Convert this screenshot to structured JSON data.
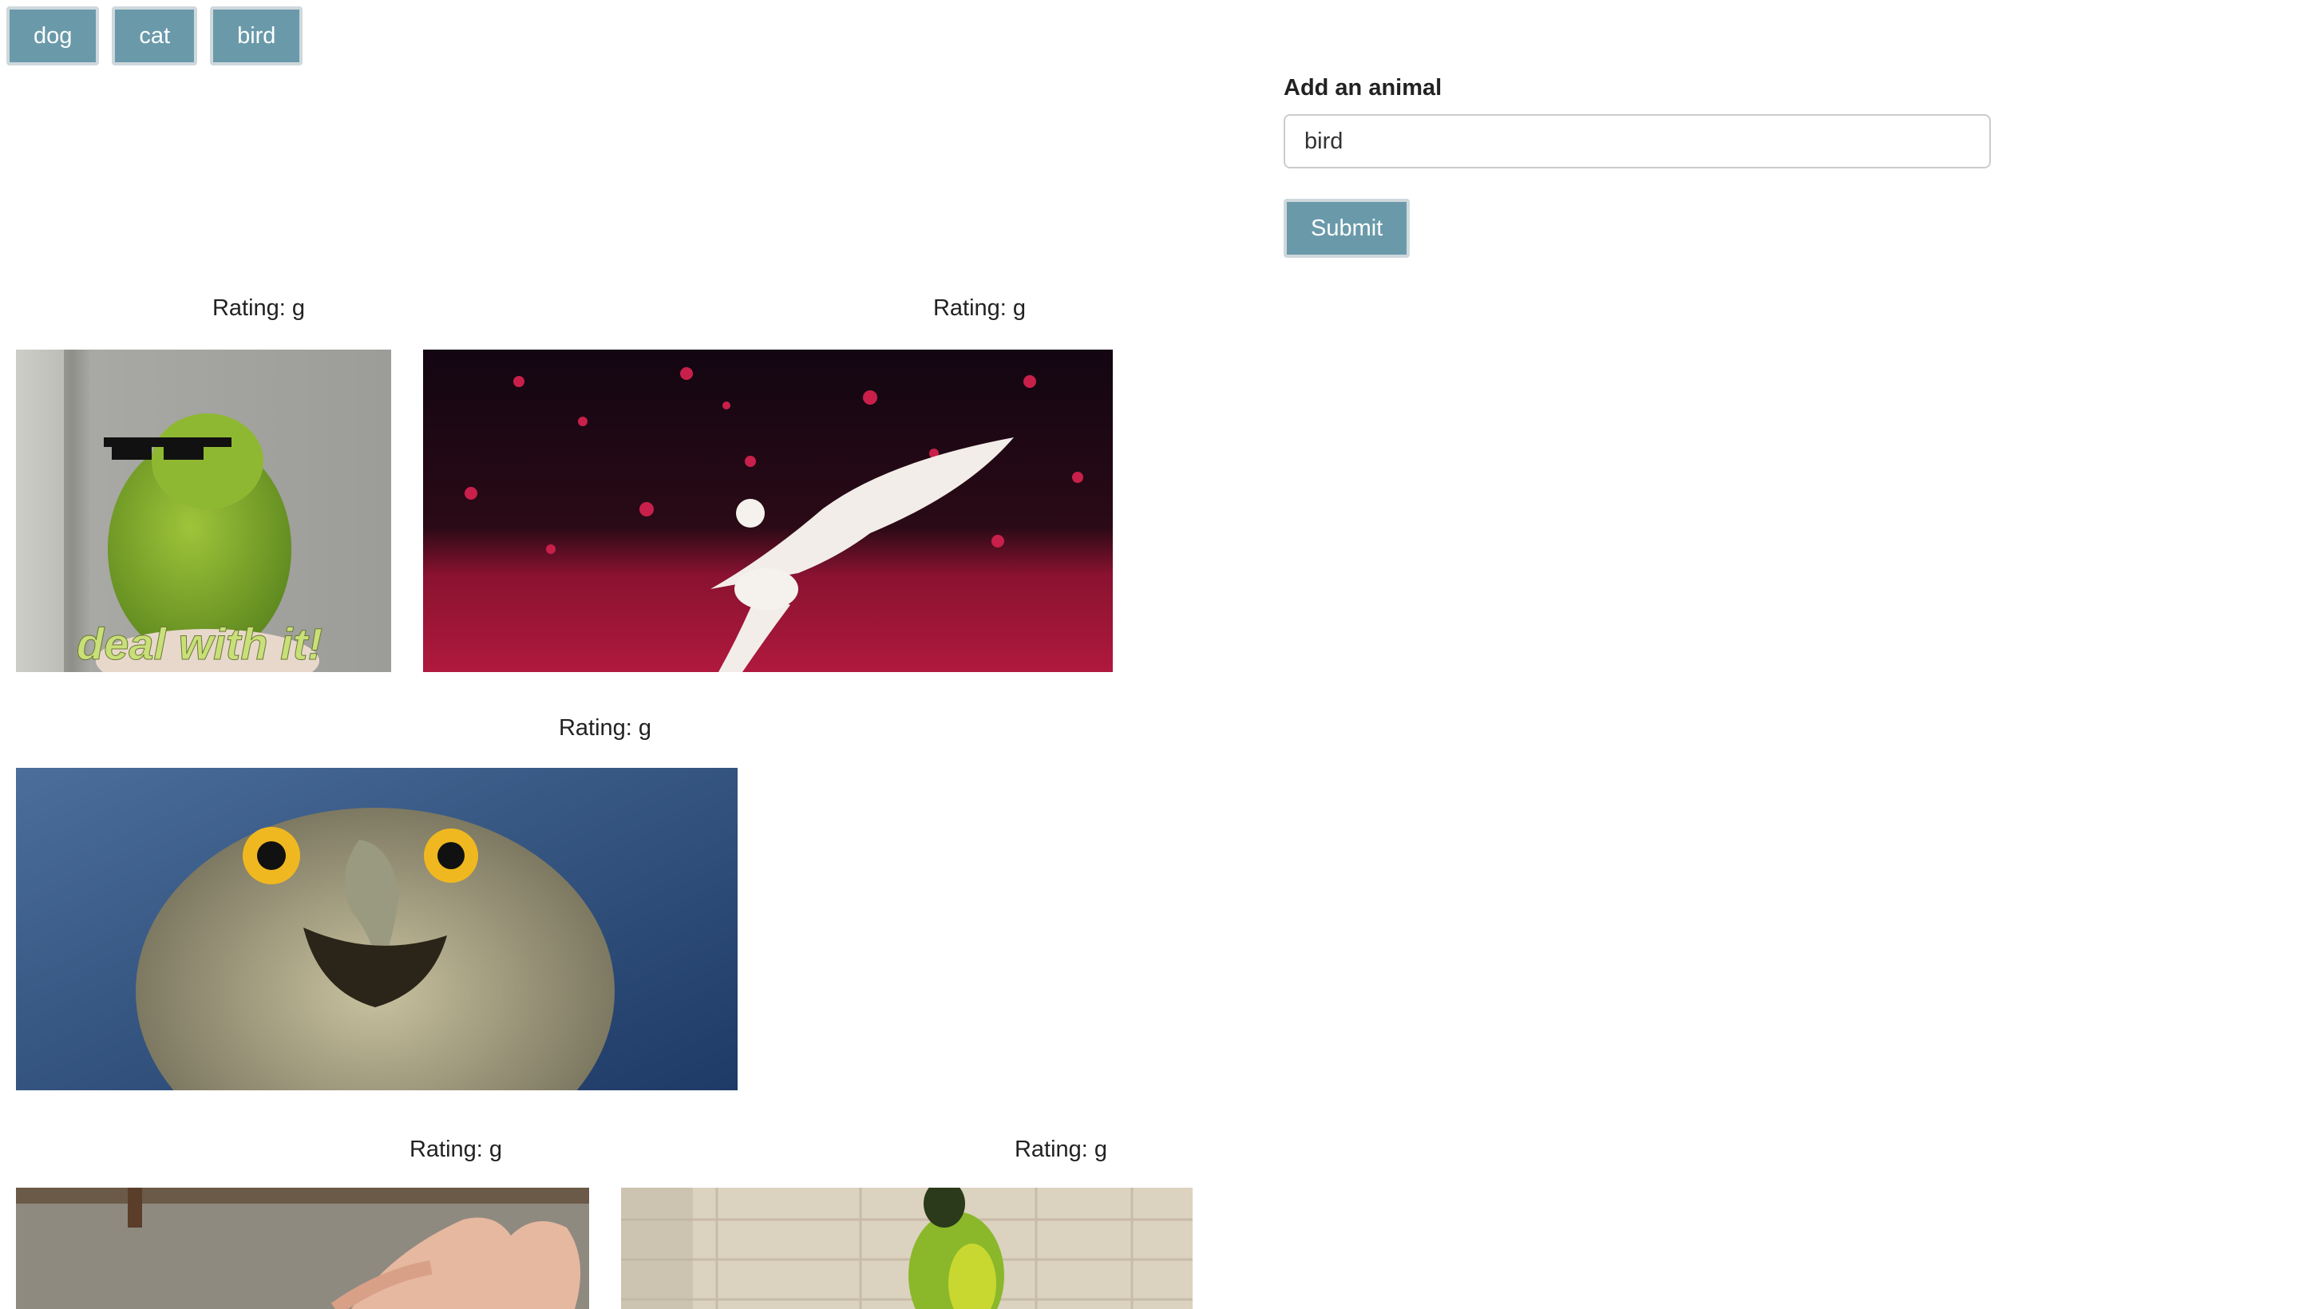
{
  "filters": {
    "buttons": [
      {
        "label": "dog"
      },
      {
        "label": "cat"
      },
      {
        "label": "bird"
      }
    ]
  },
  "form": {
    "label": "Add an animal",
    "input_value": "bird",
    "submit_label": "Submit"
  },
  "gifs": [
    {
      "rating": "Rating: g",
      "caption": "deal with it!"
    },
    {
      "rating": "Rating: g"
    },
    {
      "rating": "Rating: g"
    },
    {
      "rating": "Rating: g"
    },
    {
      "rating": "Rating: g"
    }
  ],
  "colors": {
    "button_bg": "#6a9aaa",
    "button_border": "#cfd8dc"
  }
}
